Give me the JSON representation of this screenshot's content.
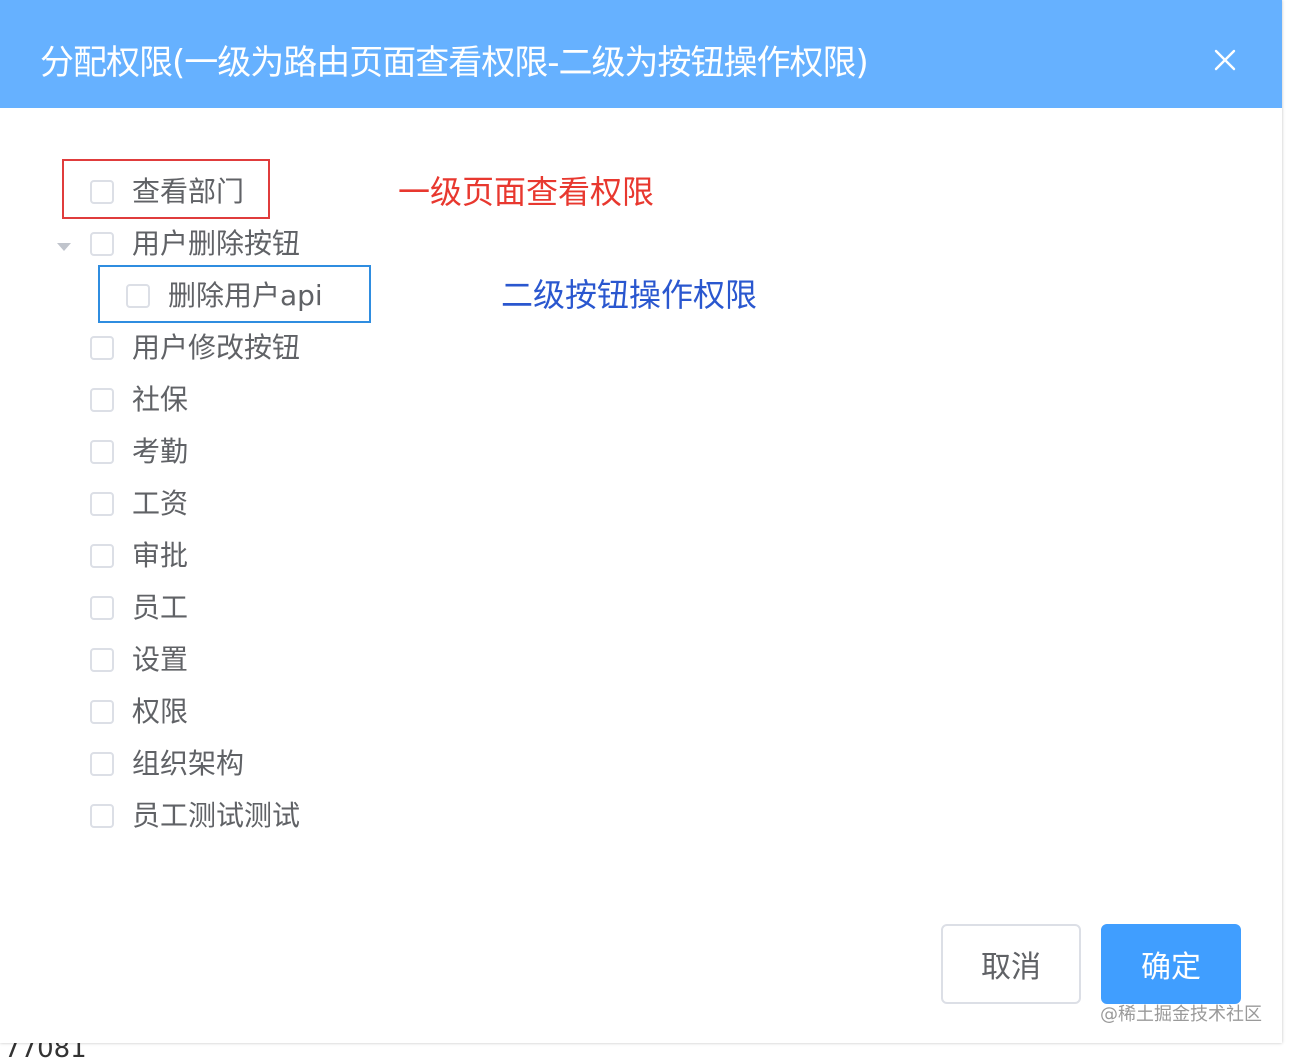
{
  "background_fragment": "77081",
  "dialog": {
    "title": "分配权限(一级为路由页面查看权限-二级为按钮操作权限)",
    "close_glyph": "×",
    "header_color": "#66b1ff"
  },
  "tree": {
    "nodes": [
      {
        "label": "查看部门",
        "level": 1,
        "checked": false
      },
      {
        "label": "用户删除按钮",
        "level": 1,
        "checked": false,
        "expanded": true
      },
      {
        "label": "删除用户api",
        "level": 2,
        "checked": false
      },
      {
        "label": "用户修改按钮",
        "level": 1,
        "checked": false
      },
      {
        "label": "社保",
        "level": 1,
        "checked": false
      },
      {
        "label": "考勤",
        "level": 1,
        "checked": false
      },
      {
        "label": "工资",
        "level": 1,
        "checked": false
      },
      {
        "label": "审批",
        "level": 1,
        "checked": false
      },
      {
        "label": "员工",
        "level": 1,
        "checked": false
      },
      {
        "label": "设置",
        "level": 1,
        "checked": false
      },
      {
        "label": "权限",
        "level": 1,
        "checked": false
      },
      {
        "label": "组织架构",
        "level": 1,
        "checked": false
      },
      {
        "label": "员工测试测试",
        "level": 1,
        "checked": false
      }
    ]
  },
  "annotations": {
    "level1": "一级页面查看权限",
    "level2": "二级按钮操作权限",
    "red": "#e8382f",
    "blue": "#2a57cf"
  },
  "footer": {
    "cancel_label": "取消",
    "confirm_label": "确定",
    "primary_color": "#409eff"
  },
  "watermark": "@稀土掘金技术社区",
  "icons": {
    "close": "close-icon",
    "expand": "caret-down-icon"
  }
}
